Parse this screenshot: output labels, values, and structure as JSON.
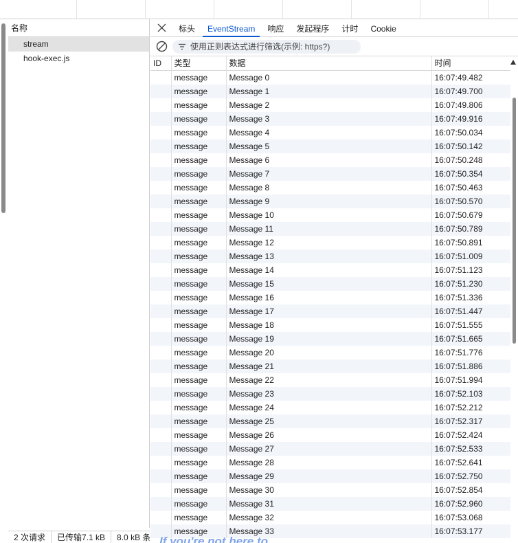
{
  "request_list": {
    "header": "名称",
    "items": [
      {
        "name": "stream",
        "selected": true
      },
      {
        "name": "hook-exec.js",
        "selected": false
      }
    ]
  },
  "status_bar": {
    "requests": "2 次请求",
    "transferred": "已传输7.1 kB",
    "resources": "8.0 kB 条"
  },
  "detail": {
    "close_icon": "close-icon",
    "tabs": [
      {
        "label": "标头",
        "active": false
      },
      {
        "label": "EventStream",
        "active": true
      },
      {
        "label": "响应",
        "active": false
      },
      {
        "label": "发起程序",
        "active": false
      },
      {
        "label": "计时",
        "active": false
      },
      {
        "label": "Cookie",
        "active": false
      }
    ],
    "filter": {
      "placeholder": "使用正则表达式进行筛选(示例: https?)"
    },
    "columns": {
      "id": "ID",
      "type": "类型",
      "data": "数据",
      "time": "时间"
    },
    "sort_icon": "sort-ascending-icon",
    "rows": [
      {
        "id": "",
        "type": "message",
        "data": "Message 0",
        "time": "16:07:49.482"
      },
      {
        "id": "",
        "type": "message",
        "data": "Message 1",
        "time": "16:07:49.700"
      },
      {
        "id": "",
        "type": "message",
        "data": "Message 2",
        "time": "16:07:49.806"
      },
      {
        "id": "",
        "type": "message",
        "data": "Message 3",
        "time": "16:07:49.916"
      },
      {
        "id": "",
        "type": "message",
        "data": "Message 4",
        "time": "16:07:50.034"
      },
      {
        "id": "",
        "type": "message",
        "data": "Message 5",
        "time": "16:07:50.142"
      },
      {
        "id": "",
        "type": "message",
        "data": "Message 6",
        "time": "16:07:50.248"
      },
      {
        "id": "",
        "type": "message",
        "data": "Message 7",
        "time": "16:07:50.354"
      },
      {
        "id": "",
        "type": "message",
        "data": "Message 8",
        "time": "16:07:50.463"
      },
      {
        "id": "",
        "type": "message",
        "data": "Message 9",
        "time": "16:07:50.570"
      },
      {
        "id": "",
        "type": "message",
        "data": "Message 10",
        "time": "16:07:50.679"
      },
      {
        "id": "",
        "type": "message",
        "data": "Message 11",
        "time": "16:07:50.789"
      },
      {
        "id": "",
        "type": "message",
        "data": "Message 12",
        "time": "16:07:50.891"
      },
      {
        "id": "",
        "type": "message",
        "data": "Message 13",
        "time": "16:07:51.009"
      },
      {
        "id": "",
        "type": "message",
        "data": "Message 14",
        "time": "16:07:51.123"
      },
      {
        "id": "",
        "type": "message",
        "data": "Message 15",
        "time": "16:07:51.230"
      },
      {
        "id": "",
        "type": "message",
        "data": "Message 16",
        "time": "16:07:51.336"
      },
      {
        "id": "",
        "type": "message",
        "data": "Message 17",
        "time": "16:07:51.447"
      },
      {
        "id": "",
        "type": "message",
        "data": "Message 18",
        "time": "16:07:51.555"
      },
      {
        "id": "",
        "type": "message",
        "data": "Message 19",
        "time": "16:07:51.665"
      },
      {
        "id": "",
        "type": "message",
        "data": "Message 20",
        "time": "16:07:51.776"
      },
      {
        "id": "",
        "type": "message",
        "data": "Message 21",
        "time": "16:07:51.886"
      },
      {
        "id": "",
        "type": "message",
        "data": "Message 22",
        "time": "16:07:51.994"
      },
      {
        "id": "",
        "type": "message",
        "data": "Message 23",
        "time": "16:07:52.103"
      },
      {
        "id": "",
        "type": "message",
        "data": "Message 24",
        "time": "16:07:52.212"
      },
      {
        "id": "",
        "type": "message",
        "data": "Message 25",
        "time": "16:07:52.317"
      },
      {
        "id": "",
        "type": "message",
        "data": "Message 26",
        "time": "16:07:52.424"
      },
      {
        "id": "",
        "type": "message",
        "data": "Message 27",
        "time": "16:07:52.533"
      },
      {
        "id": "",
        "type": "message",
        "data": "Message 28",
        "time": "16:07:52.641"
      },
      {
        "id": "",
        "type": "message",
        "data": "Message 29",
        "time": "16:07:52.750"
      },
      {
        "id": "",
        "type": "message",
        "data": "Message 30",
        "time": "16:07:52.854"
      },
      {
        "id": "",
        "type": "message",
        "data": "Message 31",
        "time": "16:07:52.960"
      },
      {
        "id": "",
        "type": "message",
        "data": "Message 32",
        "time": "16:07:53.068"
      },
      {
        "id": "",
        "type": "message",
        "data": "Message 33",
        "time": "16:07:53.177"
      }
    ]
  },
  "overlay": {
    "text": "If you're not here to"
  },
  "colors": {
    "accent": "#0b57d0",
    "selected_row": "#e2e2e2",
    "stripe_row": "#f2f5fa"
  }
}
